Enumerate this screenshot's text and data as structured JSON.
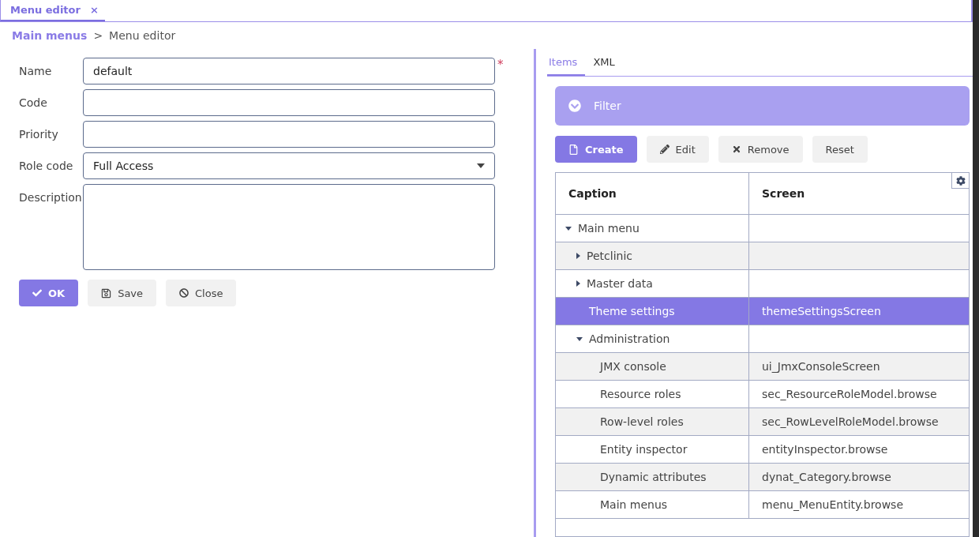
{
  "tab": {
    "label": "Menu editor",
    "close": "×",
    "selected": true
  },
  "breadcrumb": {
    "link": "Main menus",
    "separator": ">",
    "current": "Menu editor"
  },
  "form": {
    "fields": [
      {
        "label": "Name",
        "kind": "text",
        "value": "default",
        "required_mark": "*"
      },
      {
        "label": "Code",
        "kind": "text"
      },
      {
        "label": "Priority",
        "kind": "text"
      },
      {
        "label": "Role code",
        "kind": "select",
        "value": "Full Access"
      },
      {
        "label": "Description",
        "kind": "textarea"
      }
    ],
    "buttons": [
      {
        "label": "OK",
        "kind": "primary"
      },
      {
        "label": "Save",
        "kind": "save"
      },
      {
        "label": "Close",
        "kind": "close"
      }
    ]
  },
  "panel": {
    "tabs": [
      {
        "label": "Items",
        "selected": true
      },
      {
        "label": "XML",
        "selected": false
      }
    ],
    "filter": {
      "label": "Filter",
      "expanded": false
    },
    "buttons": [
      {
        "label": "Create",
        "kind": "create"
      },
      {
        "label": "Edit",
        "kind": "edit"
      },
      {
        "label": "Remove",
        "kind": "remove"
      },
      {
        "label": "Reset",
        "kind": "reset"
      }
    ],
    "table": {
      "columns": [
        "Caption",
        "Screen"
      ],
      "rows": [
        {
          "caption": "Main menu",
          "expanded": true,
          "selected": false,
          "children": [
            {
              "caption": "Petclinic",
              "expanded": false,
              "selected": false
            },
            {
              "caption": "Master data",
              "expanded": false,
              "selected": false
            },
            {
              "caption": "Theme settings",
              "screen": "themeSettingsScreen",
              "selected": true
            },
            {
              "caption": "Administration",
              "expanded": true,
              "selected": false,
              "children": [
                {
                  "caption": "JMX console",
                  "screen": "ui_JmxConsoleScreen",
                  "selected": false
                },
                {
                  "caption": "Resource roles",
                  "screen": "sec_ResourceRoleModel.browse",
                  "selected": false
                },
                {
                  "caption": "Row-level roles",
                  "screen": "sec_RowLevelRoleModel.browse",
                  "selected": false
                },
                {
                  "caption": "Entity inspector",
                  "screen": "entityInspector.browse",
                  "selected": false
                },
                {
                  "caption": "Dynamic attributes",
                  "screen": "dynat_Category.browse",
                  "selected": false
                },
                {
                  "caption": "Main menus",
                  "screen": "menu_MenuEntity.browse",
                  "selected": false
                }
              ]
            }
          ]
        }
      ]
    }
  }
}
